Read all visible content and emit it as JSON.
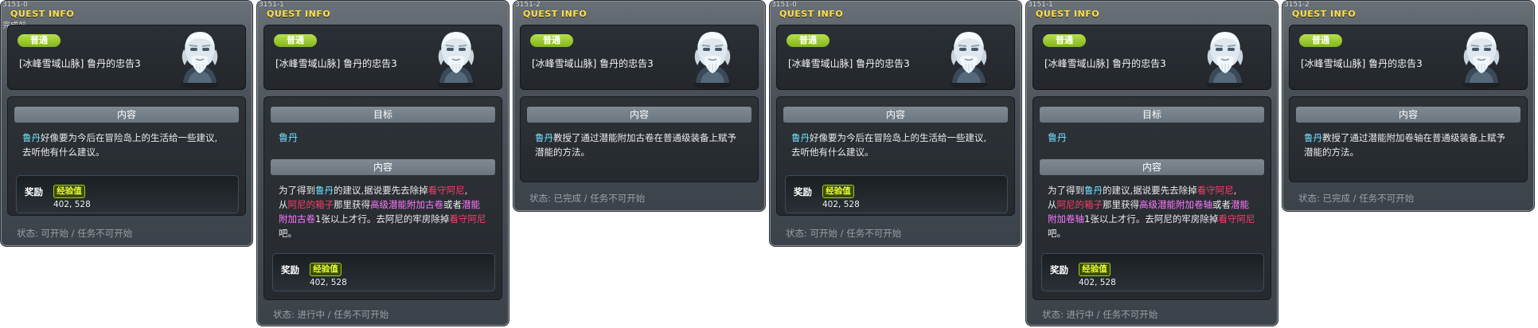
{
  "common": {
    "panel_title": "QUEST INFO",
    "badge": "普通",
    "quest_name": "[冰峰雪域山脉] 鲁丹的忠告3",
    "content_header": "内容",
    "target_header": "目标",
    "target_name": "鲁丹",
    "reward_label": "奖励",
    "exp_label": "经验值",
    "exp_value": "402, 528"
  },
  "colors": {
    "badge_green": "#8cc22a",
    "title_yellow": "#ffe14a",
    "highlight_cyan": "#6fe0ff",
    "highlight_red": "#ff3b68",
    "highlight_pink": "#ff79ff",
    "status_gray": "#9aa0a6"
  },
  "icons": {
    "npc": "npc-rudan-portrait",
    "badge": "difficulty-badge"
  },
  "panels": [
    {
      "id": "3151-0",
      "subtitle": "完成前",
      "description": {
        "line1_hl": "鲁丹",
        "line1_rest": "好像要为今后在冒险岛上的生活给一些建议,",
        "line2": "去听他有什么建议。"
      },
      "status": "状态:  可开始  /  任务不可开始"
    },
    {
      "id": "3151-1",
      "description": {
        "l1_a": "为了得到",
        "l1_hl1": "鲁丹",
        "l1_b": "的建议,据说要先去除掉",
        "l1_hl2": "看守阿尼",
        "l1_c": ",",
        "l2_a": "从",
        "l2_hl1": "阿尼的箱子",
        "l2_b": "那里获得",
        "l2_hl2": "高级潜能附加古卷",
        "l2_c": "或者",
        "l2_hl3": "潜能",
        "l3_hl1": "附加古卷",
        "l3_b": "1张以上才行。去阿尼的牢房除掉",
        "l3_hl2": "看守阿尼",
        "l4": "吧。"
      },
      "status": "状态:  进行中  /  任务不可开始"
    },
    {
      "id": "3151-2",
      "description": {
        "line1_hl": "鲁丹",
        "line1_rest": "教授了通过潜能附加古卷在普通级装备上赋予",
        "line2": "潜能的方法。"
      },
      "status": "状态:  已完成  /  任务不可开始"
    },
    {
      "id": "3151-0",
      "description": {
        "line1_hl": "鲁丹",
        "line1_rest": "好像要为今后在冒险岛上的生活给一些建议,",
        "line2": "去听他有什么建议。"
      },
      "status": "状态:  可开始  /  任务不可开始"
    },
    {
      "id": "3151-1",
      "description": {
        "l1_a": "为了得到",
        "l1_hl1": "鲁丹",
        "l1_b": "的建议,据说要先去除掉",
        "l1_hl2": "看守阿尼",
        "l1_c": ",",
        "l2_a": "从",
        "l2_hl1": "阿尼的箱子",
        "l2_b": "那里获得",
        "l2_hl2": "高级潜能附加卷轴",
        "l2_c": "或者",
        "l2_hl3": "潜能",
        "l3_hl1": "附加卷轴",
        "l3_b": "1张以上才行。去阿尼的牢房除掉",
        "l3_hl2": "看守阿尼",
        "l4": "吧。"
      },
      "status": "状态:  进行中  /  任务不可开始"
    },
    {
      "id": "3151-2",
      "description": {
        "line1_hl": "鲁丹",
        "line1_rest": "教授了通过潜能附加卷轴在普通级装备上赋予",
        "line2": "潜能的方法。"
      },
      "status": "状态:  已完成  /  任务不可开始"
    }
  ]
}
